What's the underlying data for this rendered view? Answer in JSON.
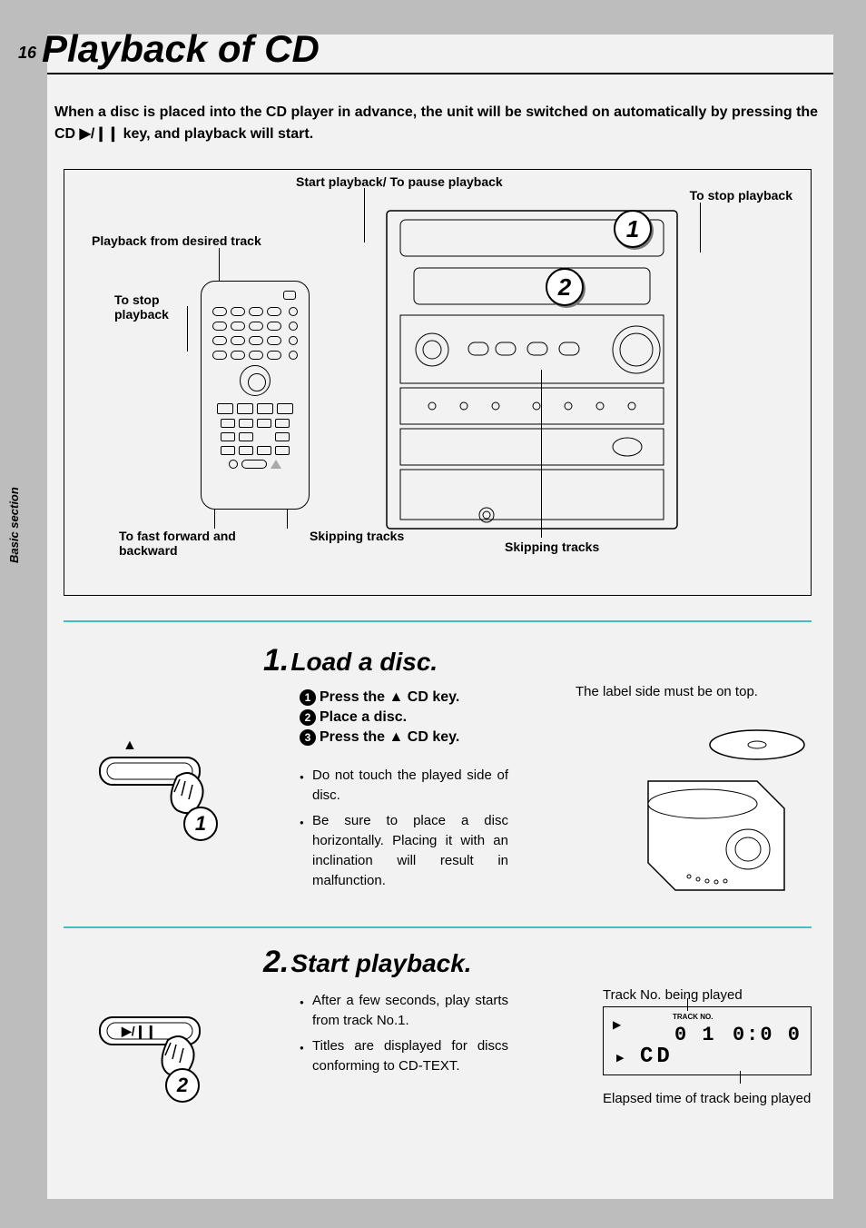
{
  "page_number": "16",
  "title": "Playback of CD",
  "side_tab": "Basic section",
  "intro_parts": {
    "before": "When a disc is placed into the CD player in advance, the unit will be switched on automatically by pressing the CD ",
    "sym": "▶/❙❙",
    "after": " key, and playback will start."
  },
  "diagram_labels": {
    "start_pause": "Start playback/ To pause playback",
    "stop_playback_right": "To stop playback",
    "desired_track": "Playback from desired track",
    "stop_playback_left": "To stop playback",
    "fast_fwd_bwd": "To fast forward and backward",
    "skipping1": "Skipping tracks",
    "skipping2": "Skipping tracks"
  },
  "badges": {
    "one": "1",
    "two": "2"
  },
  "step1": {
    "num": "1.",
    "title": "Load a disc.",
    "sub1": "Press the ▲ CD key.",
    "sub2": "Place a disc.",
    "sub3": "Press the ▲ CD key.",
    "aside": "The label side must be on top.",
    "note1": "Do not touch the played side of disc.",
    "note2": "Be sure to place a disc horizontally. Placing it with an inclination will result in malfunction."
  },
  "step2": {
    "num": "2.",
    "title": "Start playback.",
    "note1": "After a few seconds, play starts from track No.1.",
    "note2": "Titles are displayed for discs conforming to CD-TEXT.",
    "aside_top": "Track No. being played",
    "aside_bottom": "Elapsed time of track being played",
    "play_pause_sym": "▶/❙❙"
  },
  "lcd": {
    "track_no_label": "TRACK NO.",
    "track": "0 1",
    "time": "0:0 0",
    "cd": "CD",
    "play_sym": "▶"
  },
  "circnums": {
    "c1": "1",
    "c2": "2",
    "c3": "3"
  }
}
